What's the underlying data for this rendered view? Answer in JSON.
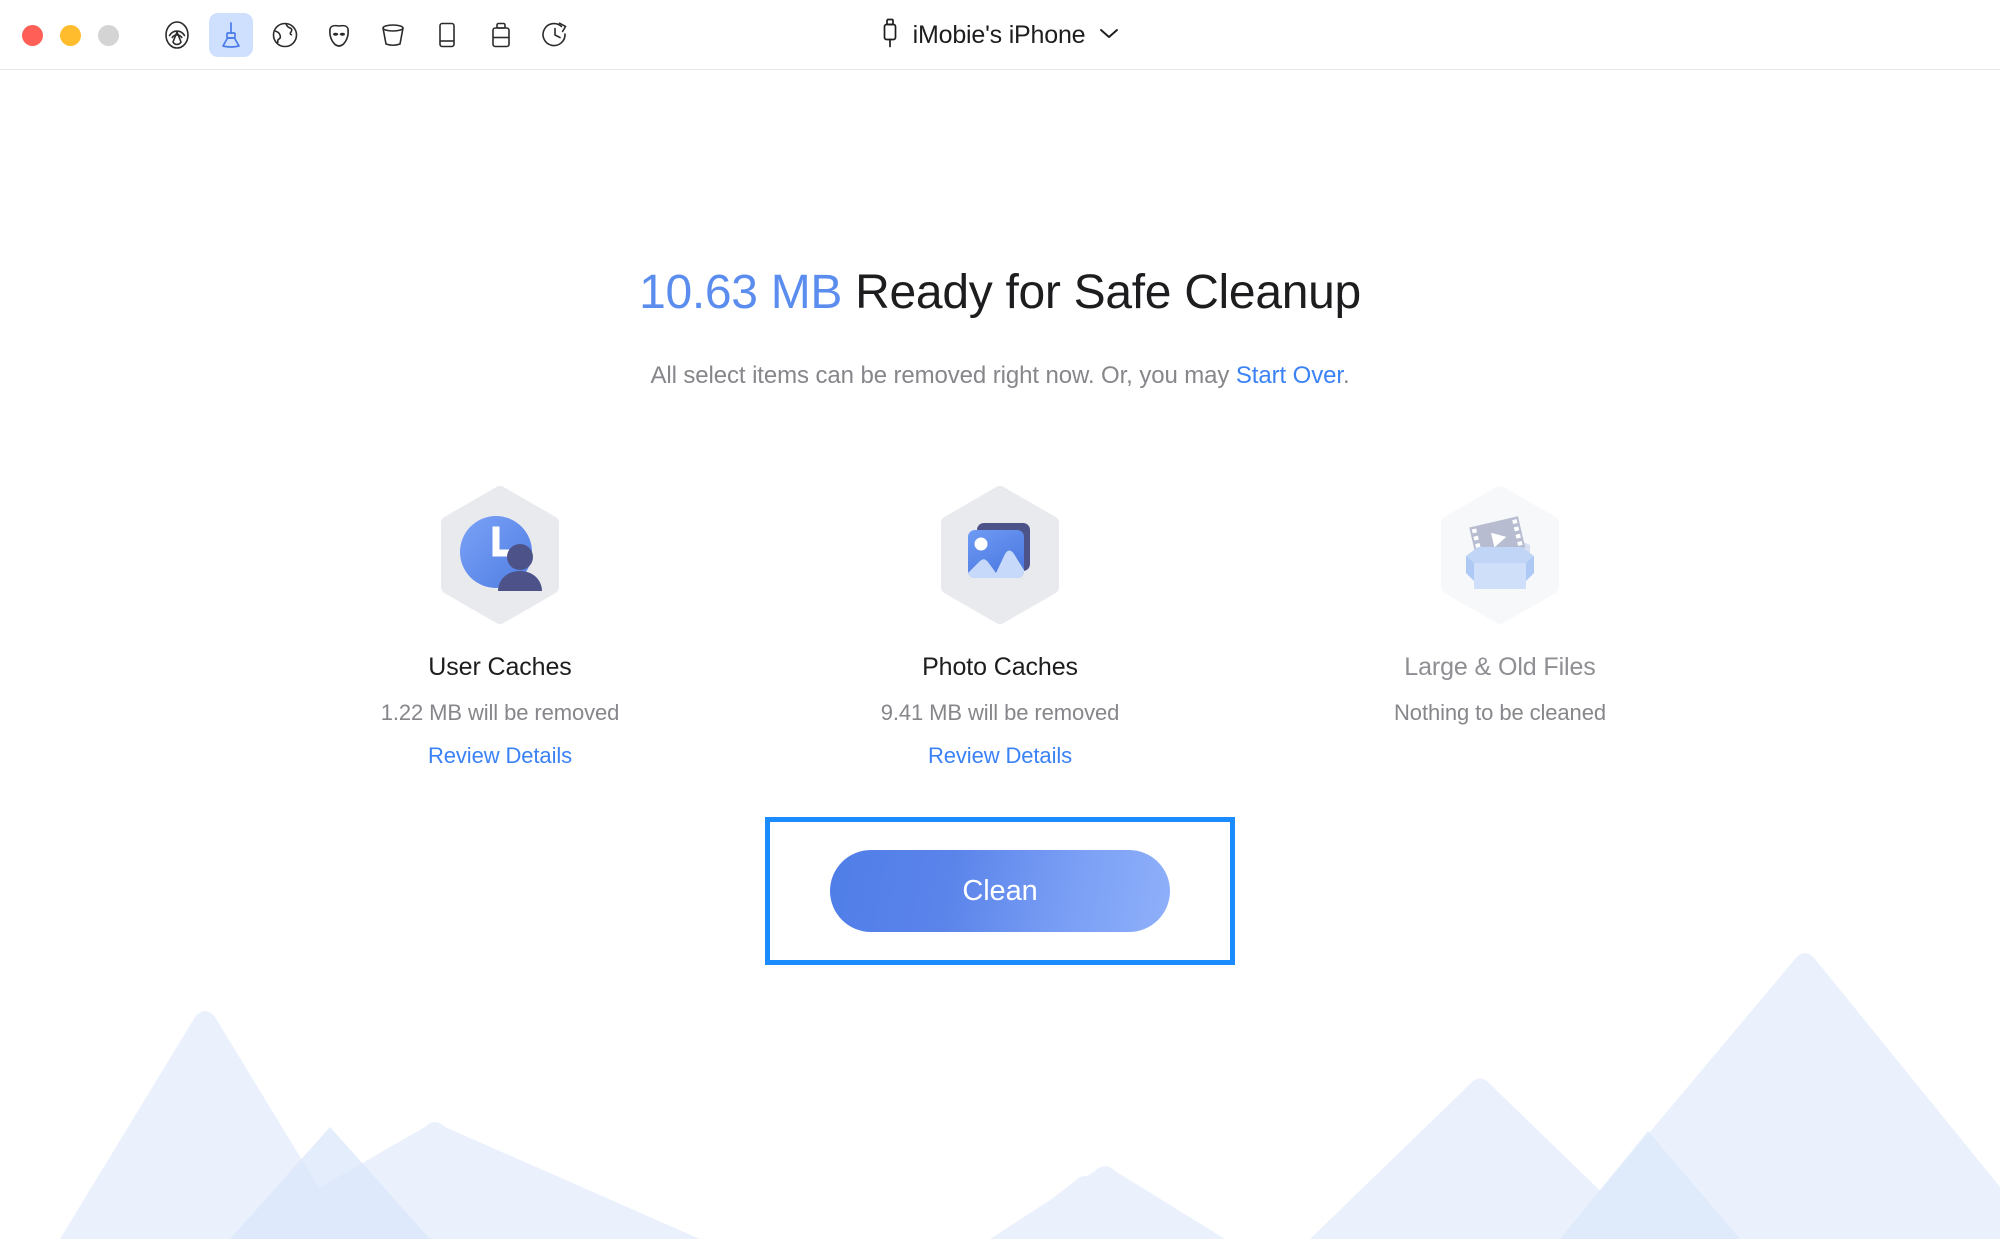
{
  "window": {
    "traffic_lights": [
      {
        "name": "close",
        "color": "#ff5f56"
      },
      {
        "name": "minimize",
        "color": "#ffbd2e"
      },
      {
        "name": "maximize",
        "color": "#d4d4d4"
      }
    ],
    "toolbar": [
      {
        "icon": "airdrop-icon",
        "label": "AirDrop",
        "active": false
      },
      {
        "icon": "broom-icon",
        "label": "Clean",
        "active": true
      },
      {
        "icon": "globe-icon",
        "label": "Browser",
        "active": false
      },
      {
        "icon": "mask-icon",
        "label": "Privacy",
        "active": false
      },
      {
        "icon": "trash-icon",
        "label": "Trash",
        "active": false
      },
      {
        "icon": "device-icon",
        "label": "Device",
        "active": false
      },
      {
        "icon": "toolbox-icon",
        "label": "Toolbox",
        "active": false
      },
      {
        "icon": "history-clock-icon",
        "label": "History",
        "active": false
      }
    ],
    "device": {
      "connector_icon": "lightning-connector-icon",
      "name": "iMobie's iPhone",
      "chevron_icon": "chevron-down-icon"
    }
  },
  "main": {
    "headline": {
      "size": "10.63 MB",
      "rest": " Ready for Safe Cleanup"
    },
    "subline": {
      "before": "All select items can be removed right now. Or, you may ",
      "link": "Start Over",
      "after": "."
    },
    "cards": [
      {
        "icon": "user-caches-icon",
        "title": "User Caches",
        "subtitle": "1.22 MB will be removed",
        "link": "Review Details",
        "has_link": true,
        "dim": false
      },
      {
        "icon": "photo-caches-icon",
        "title": "Photo Caches",
        "subtitle": "9.41 MB will be removed",
        "link": "Review Details",
        "has_link": true,
        "dim": false
      },
      {
        "icon": "large-old-files-icon",
        "title": "Large & Old Files",
        "subtitle": "Nothing to be cleaned",
        "link": "",
        "has_link": false,
        "dim": true
      }
    ],
    "clean_button": {
      "label": "Clean",
      "highlighted": true,
      "highlight_color": "#1a8cff"
    }
  },
  "colors": {
    "accent_blue": "#3b82f6",
    "headline_blue": "#5b8def",
    "annotation_blue": "#1a8cff",
    "muted_text": "#86868b",
    "mountain_light": "#eaf1fd",
    "mountain_dark": "#d8e6fb"
  }
}
